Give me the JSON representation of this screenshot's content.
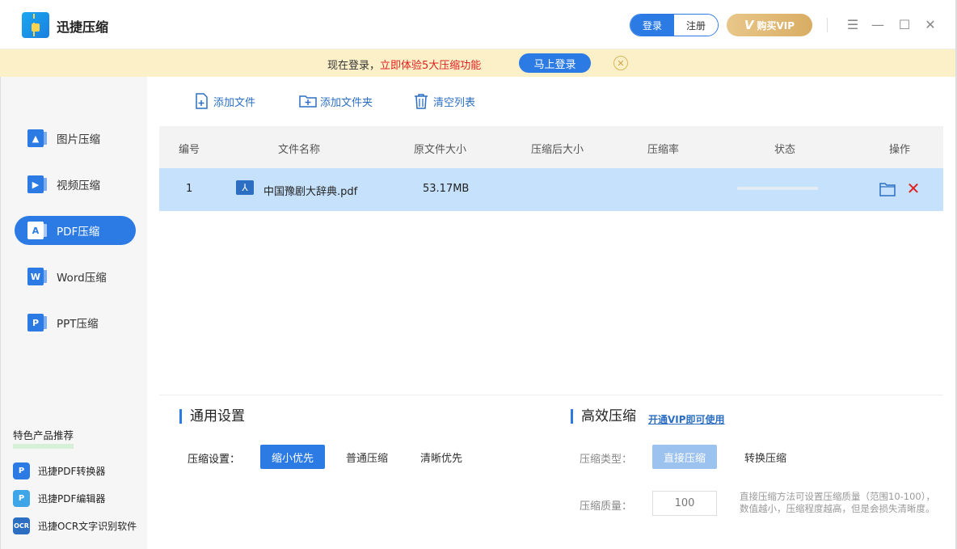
{
  "app": {
    "title": "迅捷压缩"
  },
  "header": {
    "login_label": "登录",
    "register_label": "注册",
    "vip_label": "购买VIP",
    "vip_mark": "V"
  },
  "window_controls": {
    "menu": "☰",
    "minimize": "—",
    "maximize": "☐",
    "close": "✕"
  },
  "banner": {
    "text_prefix": "现在登录，",
    "text_highlight": "立即体验5大压缩功能",
    "login_button": "马上登录",
    "close_glyph": "✕"
  },
  "sidebar": {
    "items": [
      {
        "label": "图片压缩",
        "icon": "image-compress-icon",
        "active": false
      },
      {
        "label": "视频压缩",
        "icon": "video-compress-icon",
        "active": false
      },
      {
        "label": "PDF压缩",
        "icon": "pdf-compress-icon",
        "active": true
      },
      {
        "label": "Word压缩",
        "icon": "word-compress-icon",
        "active": false
      },
      {
        "label": "PPT压缩",
        "icon": "ppt-compress-icon",
        "active": false
      }
    ],
    "recommend_title": "特色产品推荐",
    "recommend_items": [
      {
        "label": "迅捷PDF转换器",
        "icon": "pdf-converter-icon",
        "color": "#2c7be5"
      },
      {
        "label": "迅捷PDF编辑器",
        "icon": "pdf-editor-icon",
        "color": "#3ea6e8"
      },
      {
        "label": "迅捷OCR文字识别软件",
        "icon": "ocr-icon",
        "color": "#2c6fc2"
      }
    ]
  },
  "toolbar": {
    "add_file": "添加文件",
    "add_folder": "添加文件夹",
    "clear_list": "清空列表"
  },
  "table": {
    "headers": [
      "编号",
      "文件名称",
      "原文件大小",
      "压缩后大小",
      "压缩率",
      "状态",
      "操作"
    ],
    "rows": [
      {
        "index": "1",
        "name": "中国豫剧大辞典.pdf",
        "original_size": "53.17MB",
        "compressed_size": "",
        "ratio": "",
        "progress": 0
      }
    ]
  },
  "settings": {
    "general_title": "通用设置",
    "compress_label": "压缩设置：",
    "options": [
      "缩小优先",
      "普通压缩",
      "清晰优先"
    ],
    "selected_option": "缩小优先",
    "efficient_title": "高效压缩",
    "vip_link": "开通VIP即可使用",
    "type_label": "压缩类型：",
    "type_options": [
      "直接压缩",
      "转换压缩"
    ],
    "quality_label": "压缩质量：",
    "quality_value": "100",
    "hint_line1": "直接压缩方法可设置压缩质量（范围10-100），",
    "hint_line2": "数值越小，压缩程度越高，但是会损失清晰度。"
  },
  "colors": {
    "accent": "#2c7be5",
    "banner_bg": "#fcf0c8",
    "row_selected": "#c5e1fb",
    "danger": "#e02020",
    "vip_gold": "#d9ad63"
  }
}
